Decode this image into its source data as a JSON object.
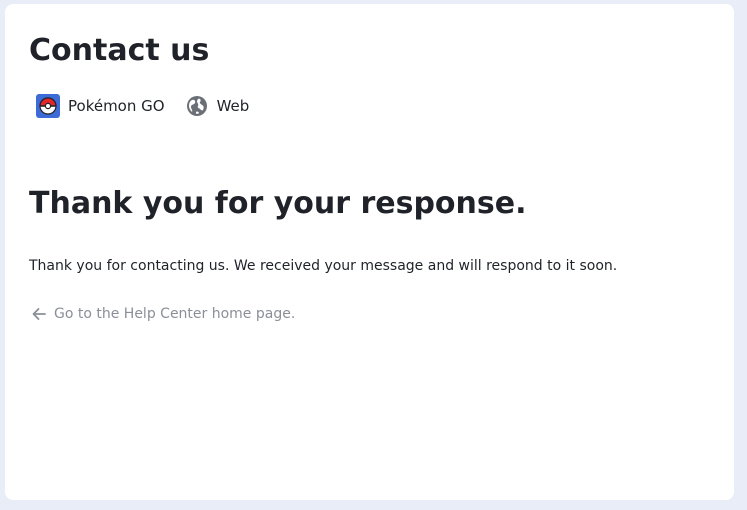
{
  "header": {
    "title": "Contact us"
  },
  "tags": [
    {
      "label": "Pokémon GO",
      "icon": "pokeball-icon"
    },
    {
      "label": "Web",
      "icon": "globe-icon"
    }
  ],
  "confirmation": {
    "heading": "Thank you for your response.",
    "message": "Thank you for contacting us. We received your message and will respond to it soon."
  },
  "back_link": {
    "label": "Go to the Help Center home page.",
    "icon": "arrow-left-icon"
  },
  "colors": {
    "page_background": "#e8edf8",
    "card_background": "#ffffff",
    "text": "#1f2329",
    "muted_link": "#8a8f98"
  }
}
